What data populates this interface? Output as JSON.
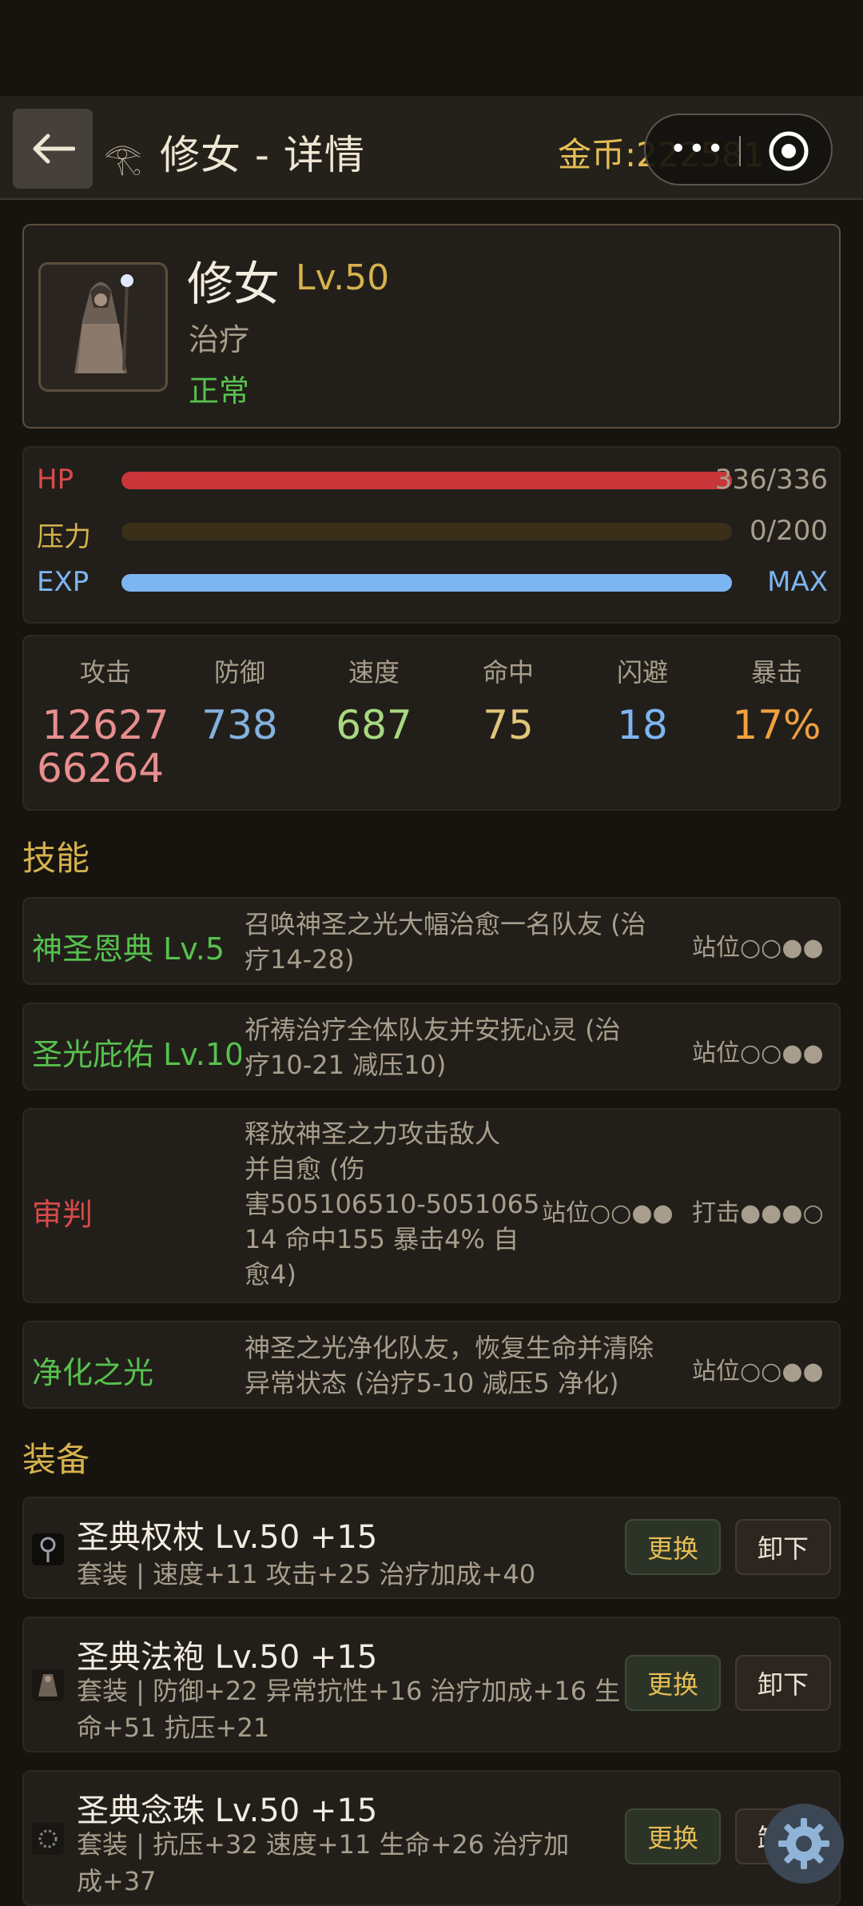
{
  "header": {
    "back_icon": "arrow-left-icon",
    "small_glyph": "𓂀",
    "title": "修女 - 详情",
    "gold": "金币:222581",
    "capsule": {
      "more_icon": "more-dots-icon",
      "close_icon": "target-circle-icon"
    }
  },
  "hero": {
    "name": "修女",
    "level": "Lv.50",
    "role": "治疗",
    "status": "正常",
    "portrait_icon": "nun-portrait-icon"
  },
  "bars": [
    {
      "label": "HP",
      "value": "336/336",
      "fill": 1.0,
      "color": "#c8363a",
      "label_color": "#d84a4a"
    },
    {
      "label": "压力",
      "value": "0/200",
      "fill": 0.0,
      "color": "#3a3019",
      "label_color": "#d6b24e"
    },
    {
      "label": "EXP",
      "value": "MAX",
      "fill": 1.0,
      "color": "#7db5f2",
      "label_color": "#7db5f2"
    }
  ],
  "stats": [
    {
      "label": "攻击",
      "value": "12627",
      "color": "#e88e8e"
    },
    {
      "label": "防御",
      "value": "738",
      "color": "#85b1e0"
    },
    {
      "label": "速度",
      "value": "687",
      "color": "#a9d880"
    },
    {
      "label": "命中",
      "value": "75",
      "color": "#e0c67a"
    },
    {
      "label": "闪避",
      "value": "18",
      "color": "#7db5f2"
    },
    {
      "label": "暴击",
      "value": "17%",
      "color": "#f0a040"
    }
  ],
  "stats_extra": "66264",
  "sections": {
    "skills": "技能",
    "equipment": "装备"
  },
  "skills": [
    {
      "name": "神圣恩典 Lv.5",
      "color": "#57c14e",
      "desc": [
        "召唤神圣之光大幅治愈一名队友 (治",
        "疗14-28)"
      ],
      "pos": "站位○○●●"
    },
    {
      "name": "圣光庇佑 Lv.10",
      "color": "#57c14e",
      "desc": [
        "祈祷治疗全体队友并安抚心灵 (治",
        "疗10-21 减压10)"
      ],
      "pos": "站位○○●●"
    },
    {
      "name": "审判",
      "color": "#d84a4a",
      "desc": [
        "释放神圣之力攻击敌人",
        "并自愈 (伤",
        "害505106510-5051065",
        "14 命中155 暴击4% 自",
        "愈4)"
      ],
      "pos": "站位○○●●",
      "hit": "打击●●●○"
    },
    {
      "name": "净化之光",
      "color": "#57c14e",
      "desc": [
        "神圣之光净化队友，恢复生命并清除",
        "异常状态 (治疗5-10 减压5 净化)"
      ],
      "pos": "站位○○●●"
    }
  ],
  "equipment": [
    {
      "name": "圣典权杖 Lv.50 +15",
      "icon": "scepter-icon",
      "desc": [
        "套装 | 速度+11 攻击+25 治疗加成+40"
      ],
      "swap": "更换",
      "remove": "卸下"
    },
    {
      "name": "圣典法袍 Lv.50 +15",
      "icon": "robe-icon",
      "desc": [
        "套装 | 防御+22 异常抗性+16 治疗加成+16 生",
        "命+51 抗压+21"
      ],
      "swap": "更换",
      "remove": "卸下"
    },
    {
      "name": "圣典念珠 Lv.50 +15",
      "icon": "rosary-icon",
      "desc": [
        "套装 | 抗压+32 速度+11 生命+26 治疗加",
        "成+37"
      ],
      "swap": "更换",
      "remove": "卸下"
    }
  ],
  "floating": {
    "settings_icon": "gear-icon"
  }
}
